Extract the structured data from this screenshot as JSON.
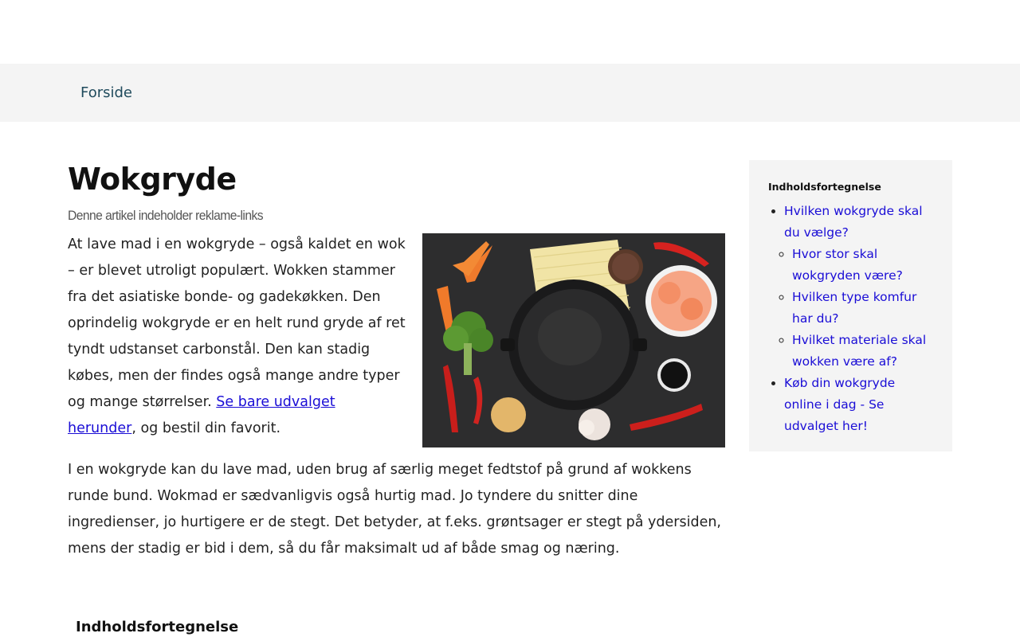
{
  "nav": {
    "home_label": "Forside"
  },
  "article": {
    "title": "Wokgryde",
    "disclaimer": "Denne artikel indeholder reklame-links",
    "p1_text": "At lave mad i en wokgryde – også kaldet en wok – er blevet utroligt populært. Wokken stammer fra det asiatiske bonde- og gadekøkken. Den oprindelig wokgryde er en helt rund gryde af ret tyndt udstanset carbonstål. Den kan stadig købes, men der findes også mange andre typer og mange størrelser. ",
    "p1_link": "Se bare udvalget herunder",
    "p1_after": ", og bestil din favorit.",
    "p2_text": "I en wokgryde kan du lave mad, uden brug af særlig meget fedtstof på grund af wokkens runde bund. Wokmad er sædvanligvis også hurtig mad. Jo tyndere du snitter dine ingredienser, jo hurtigere er de stegt. Det betyder, at f.eks. grøntsager er stegt på ydersiden, mens der stadig er bid i dem, så du får maksimalt ud af både smag og næring.",
    "toc_heading": "Indholdsfortegnelse"
  },
  "sidebar": {
    "heading": "Indholdsfortegnelse",
    "item1": "Hvilken wokgryde skal du vælge?",
    "sub1": "Hvor stor skal wokgryden være?",
    "sub2": "Hvilken type komfur har du?",
    "sub3": "Hvilket materiale skal wokken være af?",
    "item2": "Køb din wokgryde online i dag - Se udvalget her!"
  },
  "image": {
    "icon": "wok-ingredients-photo",
    "bg_color": "#2a2a2c"
  }
}
